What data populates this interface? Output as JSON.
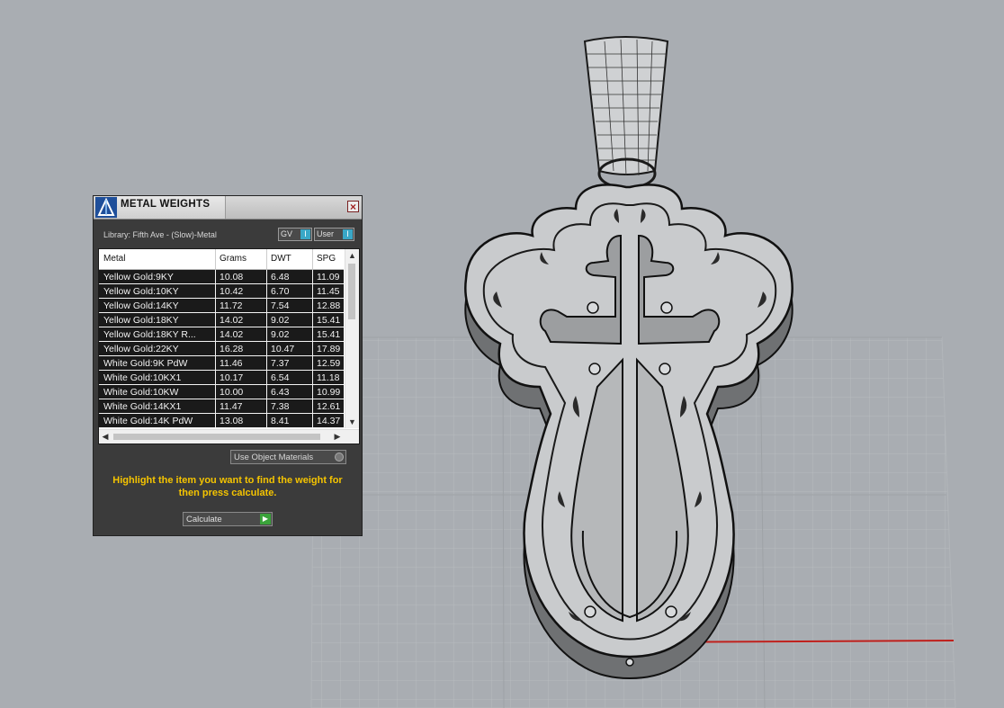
{
  "panel": {
    "title": "METAL WEIGHTS",
    "close_symbol": "×",
    "library_label": "Library: Fifth Ave - (Slow)-Metal",
    "gv_label": "GV",
    "user_label": "User",
    "toggle_mark": "I",
    "columns": [
      "Metal",
      "Grams",
      "DWT",
      "SPG"
    ],
    "rows": [
      {
        "metal": "Yellow Gold:9KY",
        "grams": "10.08",
        "dwt": "6.48",
        "spg": "11.09"
      },
      {
        "metal": "Yellow Gold:10KY",
        "grams": "10.42",
        "dwt": "6.70",
        "spg": "11.45"
      },
      {
        "metal": "Yellow Gold:14KY",
        "grams": "11.72",
        "dwt": "7.54",
        "spg": "12.88"
      },
      {
        "metal": "Yellow Gold:18KY",
        "grams": "14.02",
        "dwt": "9.02",
        "spg": "15.41"
      },
      {
        "metal": "Yellow Gold:18KY R...",
        "grams": "14.02",
        "dwt": "9.02",
        "spg": "15.41"
      },
      {
        "metal": "Yellow Gold:22KY",
        "grams": "16.28",
        "dwt": "10.47",
        "spg": "17.89"
      },
      {
        "metal": "White Gold:9K PdW",
        "grams": "11.46",
        "dwt": "7.37",
        "spg": "12.59"
      },
      {
        "metal": "White Gold:10KX1",
        "grams": "10.17",
        "dwt": "6.54",
        "spg": "11.18"
      },
      {
        "metal": "White Gold:10KW",
        "grams": "10.00",
        "dwt": "6.43",
        "spg": "10.99"
      },
      {
        "metal": "White Gold:14KX1",
        "grams": "11.47",
        "dwt": "7.38",
        "spg": "12.61"
      },
      {
        "metal": "White Gold:14K PdW",
        "grams": "13.08",
        "dwt": "8.41",
        "spg": "14.37"
      }
    ],
    "use_materials_label": "Use Object Materials",
    "instruction": "Highlight the item you want to find the weight for then press calculate.",
    "calculate_label": "Calculate",
    "calculate_arrow": "▶"
  },
  "scrollbar": {
    "up": "▲",
    "down": "▼",
    "left": "◀",
    "right": "▶"
  },
  "colors": {
    "viewport_bg": "#a9adb2",
    "instruction_text": "#f5c400",
    "toggle_on": "#39a7c7",
    "calc_go": "#3aa33a",
    "x_axis": "#c0201c",
    "y_axis": "#18a6b6"
  }
}
